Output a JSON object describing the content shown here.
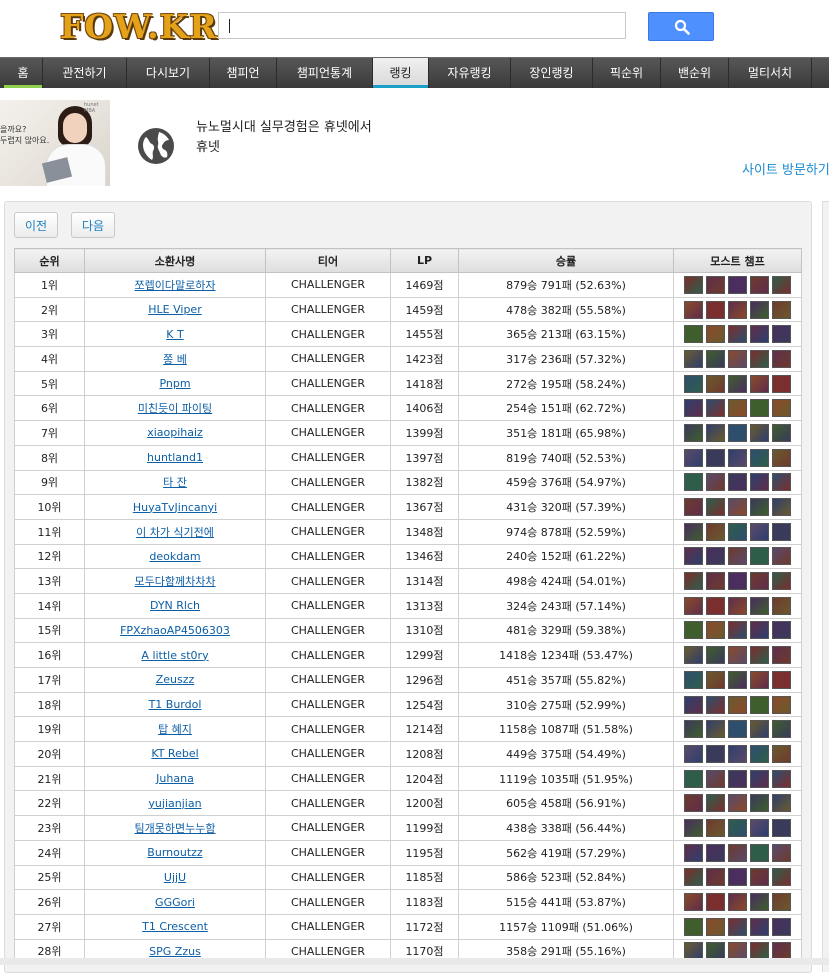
{
  "header": {
    "logo": "FOW.KR",
    "search_value": "",
    "search_button_icon": "search-icon"
  },
  "nav": [
    {
      "label": "홈",
      "left": 0
    },
    {
      "label": "관전하기"
    },
    {
      "label": "다시보기"
    },
    {
      "label": "챔피언"
    },
    {
      "label": "챔피언통계"
    },
    {
      "label": "랭킹"
    },
    {
      "label": "자유랭킹"
    },
    {
      "label": "장인랭킹"
    },
    {
      "label": "픽순위"
    },
    {
      "label": "밴순위"
    },
    {
      "label": "멀티서치"
    }
  ],
  "ad": {
    "photo_text_1": "을까요?",
    "photo_text_2": "두렵지 않아요.",
    "photo_tiny": "hunet MBA",
    "title": "뉴노멀시대 실무경험은 휴넷에서",
    "brand": "휴넷",
    "visit": "사이트 방문하기"
  },
  "pagination": {
    "prev": "이전",
    "next": "다음"
  },
  "table": {
    "headers": [
      "순위",
      "소환사명",
      "티어",
      "LP",
      "승률",
      "모스트 챔프"
    ],
    "rows": [
      {
        "rank": "1위",
        "name": "쪼렙이다말로하자",
        "tier": "CHALLENGER",
        "lp": "1469점",
        "record": "879승 791패 (52.63%)"
      },
      {
        "rank": "2위",
        "name": "HLE Viper",
        "tier": "CHALLENGER",
        "lp": "1459점",
        "record": "478승 382패 (55.58%)"
      },
      {
        "rank": "3위",
        "name": "K T",
        "tier": "CHALLENGER",
        "lp": "1455점",
        "record": "365승 213패 (63.15%)"
      },
      {
        "rank": "4위",
        "name": "쫑 베",
        "tier": "CHALLENGER",
        "lp": "1423점",
        "record": "317승 236패 (57.32%)"
      },
      {
        "rank": "5위",
        "name": "Pnpm",
        "tier": "CHALLENGER",
        "lp": "1418점",
        "record": "272승 195패 (58.24%)"
      },
      {
        "rank": "6위",
        "name": "미친듯이 파이팅",
        "tier": "CHALLENGER",
        "lp": "1406점",
        "record": "254승 151패 (62.72%)"
      },
      {
        "rank": "7위",
        "name": "xiaopihaiz",
        "tier": "CHALLENGER",
        "lp": "1399점",
        "record": "351승 181패 (65.98%)"
      },
      {
        "rank": "8위",
        "name": "huntland1",
        "tier": "CHALLENGER",
        "lp": "1397점",
        "record": "819승 740패 (52.53%)"
      },
      {
        "rank": "9위",
        "name": "타 잔",
        "tier": "CHALLENGER",
        "lp": "1382점",
        "record": "459승 376패 (54.97%)"
      },
      {
        "rank": "10위",
        "name": "HuyaTvJincanyi",
        "tier": "CHALLENGER",
        "lp": "1367점",
        "record": "431승 320패 (57.39%)"
      },
      {
        "rank": "11위",
        "name": "이 차가 식기전에",
        "tier": "CHALLENGER",
        "lp": "1348점",
        "record": "974승 878패 (52.59%)"
      },
      {
        "rank": "12위",
        "name": "deokdam",
        "tier": "CHALLENGER",
        "lp": "1346점",
        "record": "240승 152패 (61.22%)"
      },
      {
        "rank": "13위",
        "name": "모두다함께차차차",
        "tier": "CHALLENGER",
        "lp": "1314점",
        "record": "498승 424패 (54.01%)"
      },
      {
        "rank": "14위",
        "name": "DYN Rlch",
        "tier": "CHALLENGER",
        "lp": "1313점",
        "record": "324승 243패 (57.14%)"
      },
      {
        "rank": "15위",
        "name": "FPXzhaoAP4506303",
        "tier": "CHALLENGER",
        "lp": "1310점",
        "record": "481승 329패 (59.38%)"
      },
      {
        "rank": "16위",
        "name": "A little st0ry",
        "tier": "CHALLENGER",
        "lp": "1299점",
        "record": "1418승 1234패 (53.47%)"
      },
      {
        "rank": "17위",
        "name": "Zeuszz",
        "tier": "CHALLENGER",
        "lp": "1296점",
        "record": "451승 357패 (55.82%)"
      },
      {
        "rank": "18위",
        "name": "T1 Burdol",
        "tier": "CHALLENGER",
        "lp": "1254점",
        "record": "310승 275패 (52.99%)"
      },
      {
        "rank": "19위",
        "name": "탑 혜지",
        "tier": "CHALLENGER",
        "lp": "1214점",
        "record": "1158승 1087패 (51.58%)"
      },
      {
        "rank": "20위",
        "name": "KT Rebel",
        "tier": "CHALLENGER",
        "lp": "1208점",
        "record": "449승 375패 (54.49%)"
      },
      {
        "rank": "21위",
        "name": "Juhana",
        "tier": "CHALLENGER",
        "lp": "1204점",
        "record": "1119승 1035패 (51.95%)"
      },
      {
        "rank": "22위",
        "name": "yujianjian",
        "tier": "CHALLENGER",
        "lp": "1200점",
        "record": "605승 458패 (56.91%)"
      },
      {
        "rank": "23위",
        "name": "팀개못하면누누함",
        "tier": "CHALLENGER",
        "lp": "1199점",
        "record": "438승 338패 (56.44%)"
      },
      {
        "rank": "24위",
        "name": "Burnoutzz",
        "tier": "CHALLENGER",
        "lp": "1195점",
        "record": "562승 419패 (57.29%)"
      },
      {
        "rank": "25위",
        "name": "UjjU",
        "tier": "CHALLENGER",
        "lp": "1185점",
        "record": "586승 523패 (52.84%)"
      },
      {
        "rank": "26위",
        "name": "GGGori",
        "tier": "CHALLENGER",
        "lp": "1183점",
        "record": "515승 441패 (53.87%)"
      },
      {
        "rank": "27위",
        "name": "T1 Crescent",
        "tier": "CHALLENGER",
        "lp": "1172점",
        "record": "1157승 1109패 (51.06%)"
      },
      {
        "rank": "28위",
        "name": "SPG Zzus",
        "tier": "CHALLENGER",
        "lp": "1170점",
        "record": "358승 291패 (55.16%)"
      }
    ]
  },
  "champ_palette": [
    "#7a2e2e",
    "#2e3f6e",
    "#4a2e5e",
    "#6b5a2e",
    "#2e5e4a",
    "#8a4a2a",
    "#3a3a5a",
    "#5e2e4a",
    "#2e4e6e",
    "#6e3a2e",
    "#3e5e2e",
    "#5a4a6a"
  ]
}
